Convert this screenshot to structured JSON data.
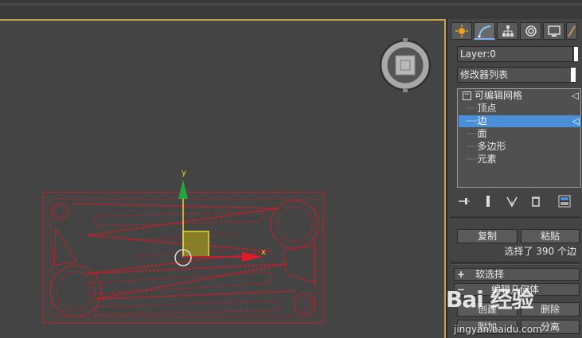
{
  "command_panel": {
    "tabs": [
      {
        "icon": "sun-icon"
      },
      {
        "icon": "modify-icon"
      },
      {
        "icon": "hierarchy-icon"
      },
      {
        "icon": "motion-icon"
      },
      {
        "icon": "display-icon"
      },
      {
        "icon": "utilities-icon"
      }
    ],
    "object_name": "Layer:0",
    "modifier_list": "修改器列表",
    "stack": {
      "root": "可编辑网格",
      "items": [
        "顶点",
        "边",
        "面",
        "多边形",
        "元素"
      ],
      "selected": "边"
    },
    "selection": {
      "copy_label": "复制",
      "paste_label": "粘贴",
      "status": "选择了 390 个边"
    },
    "rollouts": {
      "soft_selection": "软选择",
      "edit_geometry": "编辑几何体"
    },
    "geometry_buttons": {
      "create_label": "创建",
      "delete_label": "删除",
      "attach_label": "附加",
      "detach_label": "分离"
    }
  },
  "viewport": {
    "gizmo_axes": {
      "x": "x",
      "y": "y"
    },
    "colors": {
      "wire": "#c0202a",
      "accent": "#c8a24a",
      "selected": "#4a8fd8"
    }
  },
  "watermark": {
    "logo": "Bai 经验",
    "url": "jingyan.baidu.com"
  }
}
